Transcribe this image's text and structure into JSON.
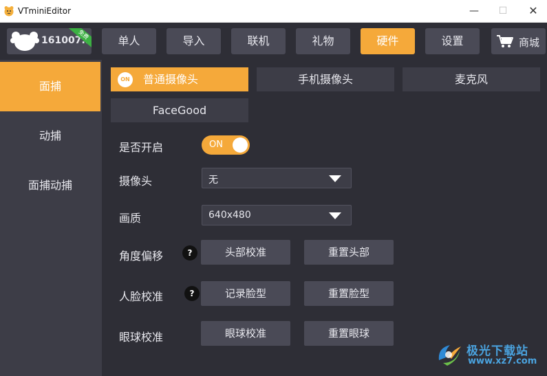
{
  "window": {
    "title": "VTminiEditor",
    "minimize_glyph": "—",
    "maximize_glyph": "☐",
    "close_glyph": "✕"
  },
  "profile": {
    "name": "161007...",
    "badge": "免费"
  },
  "nav": {
    "items": [
      {
        "label": "单人"
      },
      {
        "label": "导入"
      },
      {
        "label": "联机"
      },
      {
        "label": "礼物"
      },
      {
        "label": "硬件",
        "active": true
      },
      {
        "label": "设置"
      }
    ],
    "shop_label": "商城"
  },
  "sidebar": {
    "items": [
      {
        "label": "面捕",
        "active": true
      },
      {
        "label": "动捕"
      },
      {
        "label": "面捕动捕"
      }
    ]
  },
  "subtabs": {
    "items": [
      {
        "label": "普通摄像头",
        "active": true,
        "badge": "ON"
      },
      {
        "label": "手机摄像头"
      },
      {
        "label": "麦克风"
      },
      {
        "label": "FaceGood"
      }
    ]
  },
  "settings": {
    "enable": {
      "label": "是否开启",
      "toggle_text": "ON",
      "value": true
    },
    "camera": {
      "label": "摄像头",
      "value": "无"
    },
    "quality": {
      "label": "画质",
      "value": "640x480"
    },
    "angle_offset": {
      "label": "角度偏移",
      "help": "?",
      "buttons": [
        "头部校准",
        "重置头部"
      ]
    },
    "face_calibration": {
      "label": "人脸校准",
      "help": "?",
      "buttons": [
        "记录脸型",
        "重置脸型"
      ]
    },
    "eye_calibration": {
      "label": "眼球校准",
      "buttons": [
        "眼球校准",
        "重置眼球"
      ]
    }
  },
  "watermark": {
    "title": "极光下载站",
    "url": "www.xz7.com"
  },
  "colors": {
    "accent": "#f5a93a",
    "panel_dark": "#2e2e36",
    "panel": "#3d3d47",
    "button": "#4a4a56",
    "free_badge": "#3cb043"
  }
}
